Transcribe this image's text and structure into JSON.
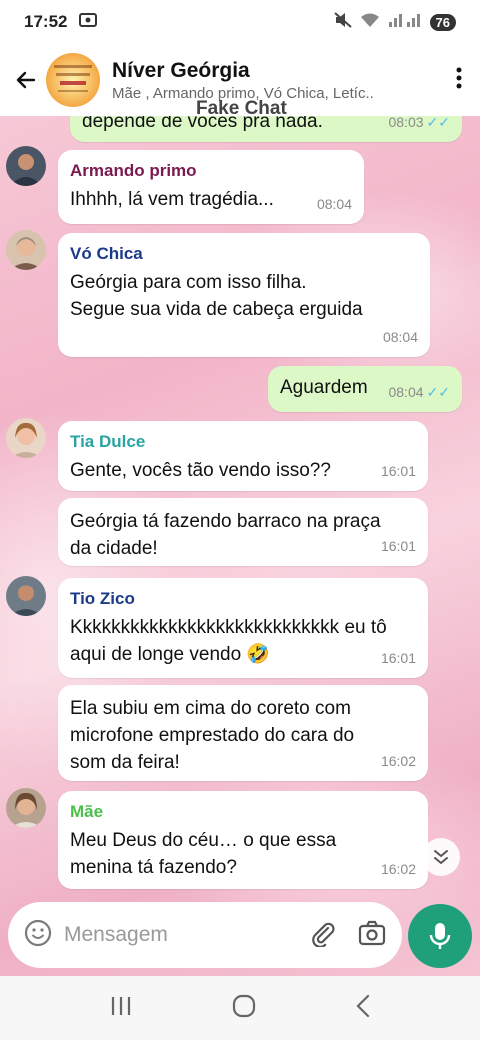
{
  "status": {
    "time": "17:52",
    "battery": "76"
  },
  "header": {
    "title": "Níver Geórgia",
    "subtitle": "Mãe , Armando primo, Vó Chica, Letíc..",
    "overlay_label": "Fake Chat",
    "avatar_text": "Você está convidado para o aniversário de 50 anos de Geórgia"
  },
  "messages": [
    {
      "text": "depende de vocês pra nada.",
      "time": "08:03"
    },
    {
      "sender": "Armando primo",
      "sender_color": "#7a1a4f",
      "text": "Ihhhh, lá vem tragédia...",
      "time": "08:04"
    },
    {
      "sender": "Vó Chica",
      "sender_color": "#1c3a8a",
      "text1": "Geórgia para com isso filha.",
      "text2": "Segue sua vida de cabeça erguida",
      "time": "08:04"
    },
    {
      "text": "Aguardem",
      "time": "08:04"
    },
    {
      "sender": "Tia Dulce",
      "sender_color": "#2aa3a3",
      "text": "Gente, vocês tão vendo isso??",
      "time": "16:01"
    },
    {
      "text1": "Geórgia tá fazendo barraco na praça",
      "text2": "da cidade!",
      "time": "16:01"
    },
    {
      "sender": "Tio Zico",
      "sender_color": "#1c3a8a",
      "text1": "Kkkkkkkkkkkkkkkkkkkkkkkkkkkk eu tô",
      "text2": "aqui de longe vendo 🤣",
      "time": "16:01"
    },
    {
      "text1": "Ela subiu em cima do coreto com",
      "text2": "microfone emprestado do cara do",
      "text3": "som da feira!",
      "time": "16:02"
    },
    {
      "sender": "Mãe",
      "sender_color": "#4cbf4c",
      "text1": "Meu Deus do céu… o que essa",
      "text2": "menina tá fazendo?",
      "time": "16:02"
    }
  ],
  "input": {
    "placeholder": "Mensagem"
  },
  "colors": {
    "outgoing": "#dcf8c6",
    "mic": "#1fa07a",
    "ticks": "#53bdeb"
  }
}
